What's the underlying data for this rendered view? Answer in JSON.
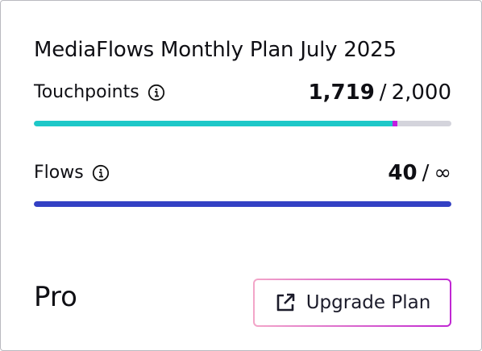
{
  "card": {
    "title": "MediaFlows Monthly Plan July 2025",
    "metrics": [
      {
        "label": "Touchpoints",
        "icon": "info-icon",
        "used": "1,719",
        "separator": "/",
        "limit": "2,000",
        "progress_fraction": 0.8595,
        "bar_color": "#1ec8c8",
        "marker_color": "#c21ee0",
        "track_color": "#d4d4dc"
      },
      {
        "label": "Flows",
        "icon": "info-icon",
        "used": "40",
        "separator": "/",
        "limit": "∞",
        "progress_fraction": 1.0,
        "bar_color": "#3340c4"
      }
    ],
    "plan_name": "Pro",
    "upgrade_button": {
      "label": "Upgrade Plan",
      "icon": "external-link-icon"
    }
  }
}
